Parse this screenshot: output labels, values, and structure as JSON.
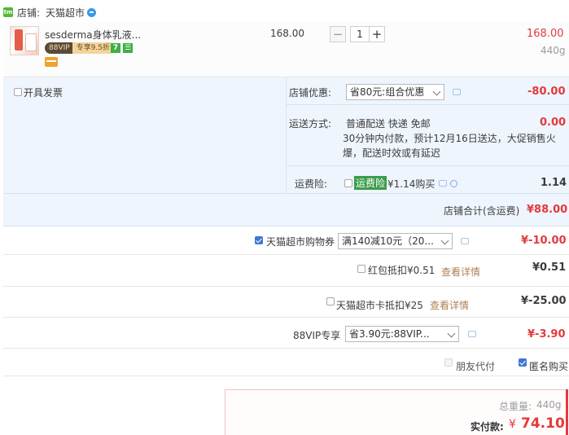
{
  "shop": {
    "label": "店铺:",
    "name": "天猫超市"
  },
  "item": {
    "title": "sesderma身体乳液...",
    "vip_left": "88VIP",
    "vip_right": "专享9.5折",
    "badge_days": "7",
    "unit_price": "168.00",
    "quantity": "1",
    "subtotal": "168.00",
    "weight": "440g"
  },
  "invoice_label": "开具发票",
  "shop_discount": {
    "label": "店铺优惠:",
    "option": "省80元:组合优惠",
    "amount": "-80.00"
  },
  "shipping": {
    "label": "运送方式:",
    "method": "普通配送 快递 免邮",
    "note_line1": "30分钟内付款，预计12月16日送达，大促销售火",
    "note_line2": "爆，配送时效或有延迟",
    "amount": "0.00"
  },
  "insurance": {
    "label": "运费险:",
    "tag": "运费险",
    "price_text": "¥1.14购买",
    "amount": "1.14"
  },
  "shop_total": {
    "label": "店铺合计(含运费)",
    "amount": "¥88.00"
  },
  "coupon": {
    "label": "天猫超市购物券",
    "option": "满140减10元（20...",
    "amount": "¥-10.00"
  },
  "red_packet": {
    "label": "红包抵扣¥0.51",
    "link": "查看详情",
    "amount": "¥0.51"
  },
  "tmall_card": {
    "label": "天猫超市卡抵扣¥25",
    "link": "查看详情",
    "amount": "¥-25.00"
  },
  "vip88": {
    "label": "88VIP专享",
    "option": "省3.90元:88VIP...",
    "amount": "¥-3.90"
  },
  "friend_pay_label": "朋友代付",
  "anonymous_label": "匿名购买",
  "summary": {
    "weight_label": "总重量:",
    "weight": "440g",
    "pay_label": "实付款:",
    "currency": "¥",
    "pay_amount": "74.10"
  },
  "colors": {
    "price_red": "#e4393c",
    "panel_blue": "#eef5fd",
    "check_blue": "#3d78d6",
    "tmall_green": "#55b837"
  }
}
